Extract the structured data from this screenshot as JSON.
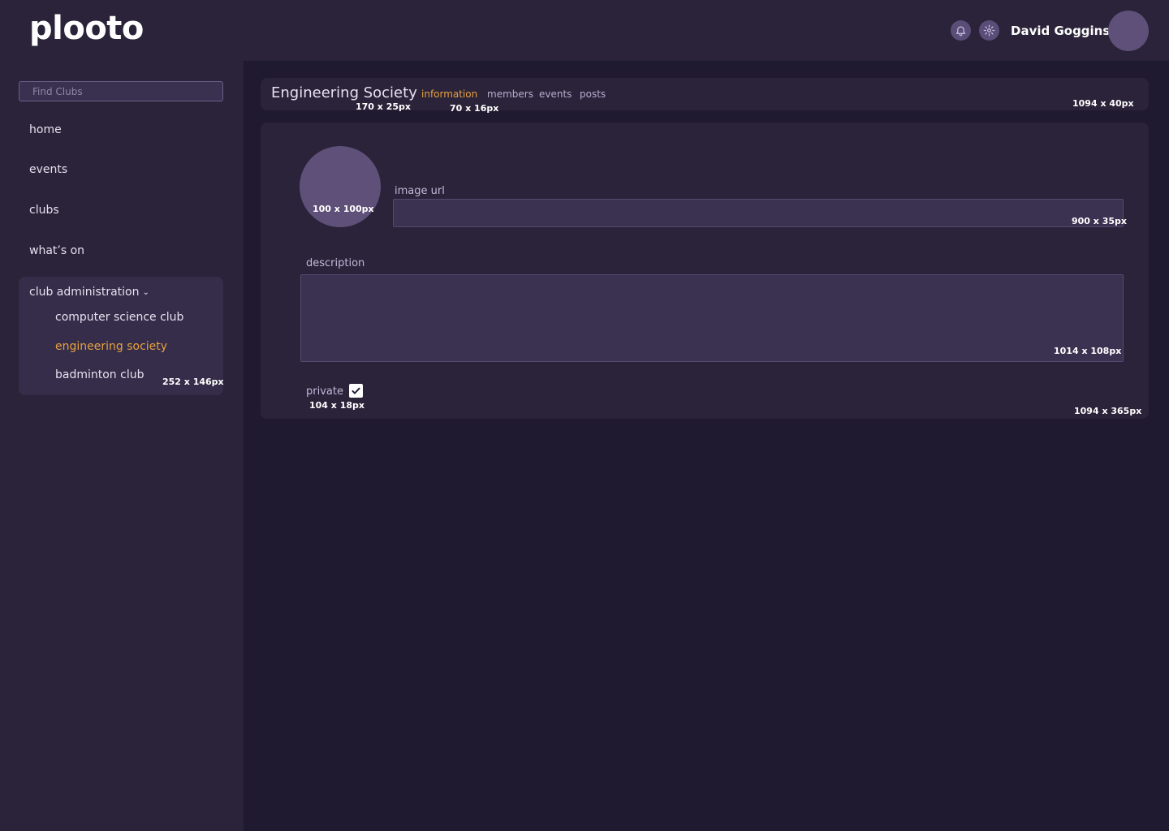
{
  "header": {
    "logo": "plooto",
    "user_name": "David Goggins",
    "icons": [
      "bell-icon",
      "gear-icon"
    ]
  },
  "sidebar": {
    "search_placeholder": "Find Clubs",
    "nav": [
      {
        "label": "home"
      },
      {
        "label": "events"
      },
      {
        "label": "clubs"
      },
      {
        "label": "what’s on"
      }
    ],
    "admin": {
      "title": "club administration",
      "items": [
        {
          "label": "computer science club",
          "active": false
        },
        {
          "label": "engineering society",
          "active": true
        },
        {
          "label": "badminton club",
          "active": false
        }
      ],
      "size_note": "252 x 146px"
    }
  },
  "club_bar": {
    "title": "Engineering Society",
    "title_size_note": "170 x 25px",
    "tabs": [
      {
        "label": "information",
        "active": true
      },
      {
        "label": "members",
        "active": false
      },
      {
        "label": "events",
        "active": false
      },
      {
        "label": "posts",
        "active": false
      }
    ],
    "tab_size_note": "70 x 16px",
    "bar_size_note": "1094 x 40px"
  },
  "info_card": {
    "image_size_note": "100 x 100px",
    "image_url_label": "image url",
    "image_url_value": "",
    "image_url_size_note": "900 x 35px",
    "description_label": "description",
    "description_value": "",
    "description_size_note": "1014 x 108px",
    "private_label": "private",
    "private_checked": true,
    "private_size_note": "104 x 18px",
    "card_size_note": "1094 x 365px"
  },
  "colors": {
    "accent": "#e8a13e",
    "background": "#1f1a30",
    "panel": "#2a2339",
    "input": "#3b3150"
  }
}
